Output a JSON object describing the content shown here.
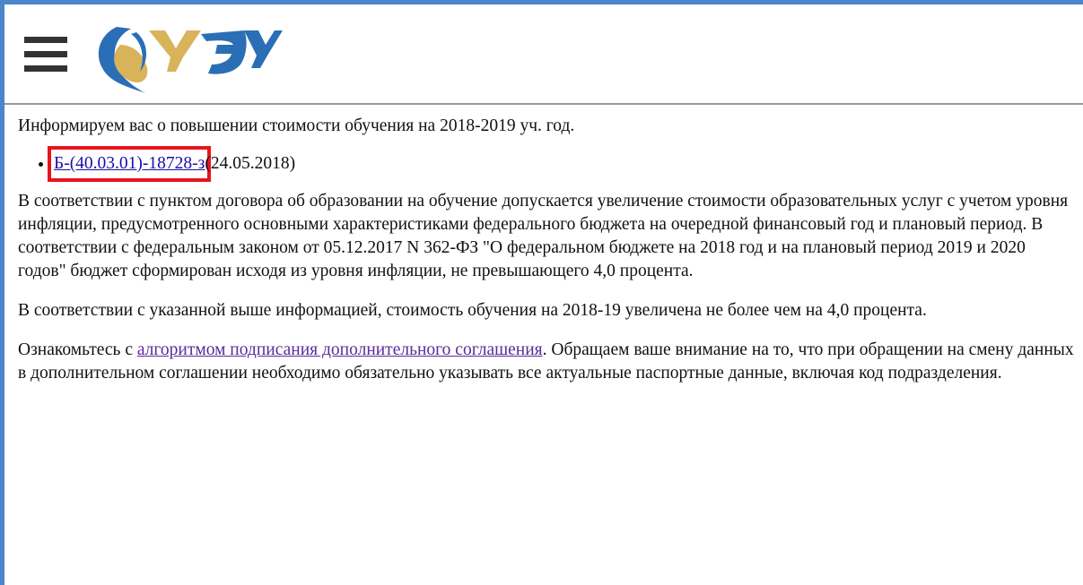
{
  "header": {
    "menu_icon": "hamburger-menu-icon",
    "logo_icon": "university-logo",
    "logo_colors": {
      "blue": "#2a6fb5",
      "gold": "#d8b35a"
    }
  },
  "content": {
    "intro": "Информируем вас о повышении стоимости обучения на 2018-2019 уч. год.",
    "documents": [
      {
        "link": "Б-(40.03.01)-18728-з",
        "date": "(24.05.2018)"
      }
    ],
    "paragraph1": "В соответствии с пунктом договора об образовании на обучение допускается увеличение стоимости образовательных услуг с учетом уровня инфляции, предусмотренного основными характеристиками федерального бюджета на очередной финансовый год и плановый период. В соответствии с федеральным законом от 05.12.2017 N 362-ФЗ \"О федеральном бюджете на 2018 год и на плановый период 2019 и 2020 годов\" бюджет сформирован исходя из уровня инфляции, не превышающего 4,0 процента.",
    "paragraph2": "В соответствии с указанной выше информацией, стоимость обучения на 2018-19 увеличена не более чем на 4,0 процента.",
    "paragraph3": {
      "before": "Ознакомьтесь с ",
      "link": "алгоритмом подписания дополнительного соглашения",
      "after": ". Обращаем ваше внимание на то, что при обращении на смену данных в дополнительном соглашении необходимо обязательно указывать все актуальные паспортные данные, включая код подразделения."
    }
  },
  "colors": {
    "frame_border": "#4a86c8",
    "highlight_box": "#e8141c",
    "link": "#1a0dab",
    "visited_link": "#5b2a9a"
  }
}
